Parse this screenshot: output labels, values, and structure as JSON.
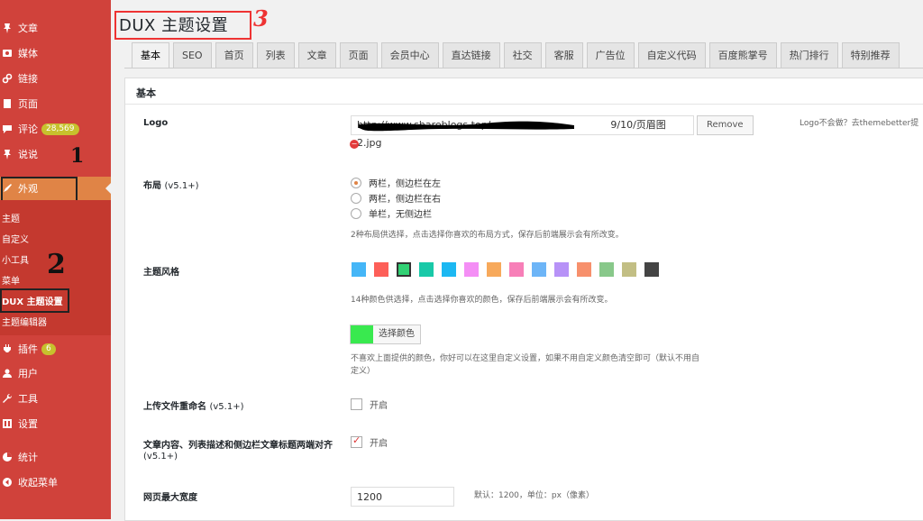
{
  "sidebar": {
    "items": [
      {
        "label": "文章",
        "icon": "pin-icon"
      },
      {
        "label": "媒体",
        "icon": "media-icon"
      },
      {
        "label": "链接",
        "icon": "link-icon"
      },
      {
        "label": "页面",
        "icon": "page-icon"
      },
      {
        "label": "评论",
        "icon": "comment-icon",
        "badge": "28,569"
      },
      {
        "label": "说说",
        "icon": "pin-icon"
      },
      {
        "label": "外观",
        "icon": "brush-icon"
      },
      {
        "label": "插件",
        "icon": "plugin-icon",
        "badge": "6"
      },
      {
        "label": "用户",
        "icon": "user-icon"
      },
      {
        "label": "工具",
        "icon": "wrench-icon"
      },
      {
        "label": "设置",
        "icon": "settings-icon"
      },
      {
        "label": "统计",
        "icon": "stats-icon"
      },
      {
        "label": "收起菜单",
        "icon": "collapse-icon"
      }
    ],
    "submenu": [
      "主题",
      "自定义",
      "小工具",
      "菜单",
      "DUX 主题设置",
      "主题编辑器"
    ]
  },
  "annotations": {
    "one": "1",
    "two": "2",
    "three": "3"
  },
  "page": {
    "title": "DUX 主题设置"
  },
  "tabs": [
    "基本",
    "SEO",
    "首页",
    "列表",
    "文章",
    "页面",
    "会员中心",
    "直达链接",
    "社交",
    "客服",
    "广告位",
    "自定义代码",
    "百度熊掌号",
    "热门排行",
    "特别推荐"
  ],
  "panel": {
    "header": "基本",
    "logo": {
      "label": "Logo",
      "value_start": "http://www.shareblogs.top/",
      "value_end": "9/10/页眉图2.jpg",
      "remove": "Remove",
      "hint": "Logo不会做？去themebetter提"
    },
    "layout": {
      "label": "布局",
      "version": "(v5.1+)",
      "options": [
        "两栏，侧边栏在左",
        "两栏，侧边栏在右",
        "单栏，无侧边栏"
      ],
      "desc": "2种布局供选择，点击选择你喜欢的布局方式，保存后前端展示会有所改变。"
    },
    "style": {
      "label": "主题风格",
      "colors": [
        "#45b6f7",
        "#fd5f58",
        "#31d174",
        "#19c9a8",
        "#1cb8f2",
        "#f48ef5",
        "#f7a95b",
        "#f77fb8",
        "#6db5f7",
        "#b792f7",
        "#f7906c",
        "#88c88a",
        "#c2be84",
        "#444444"
      ],
      "desc": "14种颜色供选择，点击选择你喜欢的颜色，保存后前端展示会有所改变。",
      "custom_color": "#39e94f",
      "pick_label": "选择颜色",
      "custom_desc_1": "不喜欢上面提供的颜色，你好可以在这里自定义设置，如果不用自定义颜色清空即可（默认不用自",
      "custom_desc_2": "定义）"
    },
    "rename": {
      "label": "上传文件重命名",
      "version": "(v5.1+)",
      "option": "开启"
    },
    "justify": {
      "label": "文章内容、列表描述和侧边栏文章标题两端对齐",
      "version": "(v5.1+)",
      "option": "开启"
    },
    "maxwidth": {
      "label": "网页最大宽度",
      "value": "1200",
      "desc": "默认：1200，单位：px（像素）"
    }
  }
}
